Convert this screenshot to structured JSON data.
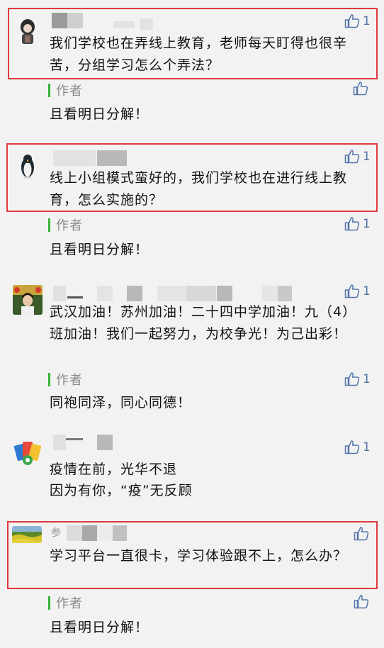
{
  "colors": {
    "highlight": "#e0393e",
    "author_bar": "#35b33a",
    "like": "#5575a8"
  },
  "comments": [
    {
      "text": "我们学校也在弄线上教育，老师每天盯得也很辛苦，分组学习怎么个弄法？",
      "likes": "1",
      "reply_author": "作者",
      "reply_likes": "",
      "reply_text": "且看明日分解！"
    },
    {
      "text": "线上小组模式蛮好的，我们学校也在进行线上教育，怎么实施的？",
      "likes": "1",
      "reply_author": "作者",
      "reply_likes": "1",
      "reply_text": "且看明日分解！"
    },
    {
      "text": "武汉加油！苏州加油！二十四中学加油！九（4）班加油！我们一起努力，为校争光！为己出彩！",
      "likes": "1",
      "reply_author": "作者",
      "reply_likes": "1",
      "reply_text": "同袍同泽，同心同德！"
    },
    {
      "text_lines": [
        "疫情在前，光华不退",
        "因为有你，“疫”无反顾"
      ],
      "likes": "1"
    },
    {
      "name_fragment": "参",
      "text": "学习平台一直很卡，学习体验跟不上，怎么办？",
      "likes": "",
      "reply_author": "作者",
      "reply_likes": "",
      "reply_text": "且看明日分解！"
    }
  ]
}
